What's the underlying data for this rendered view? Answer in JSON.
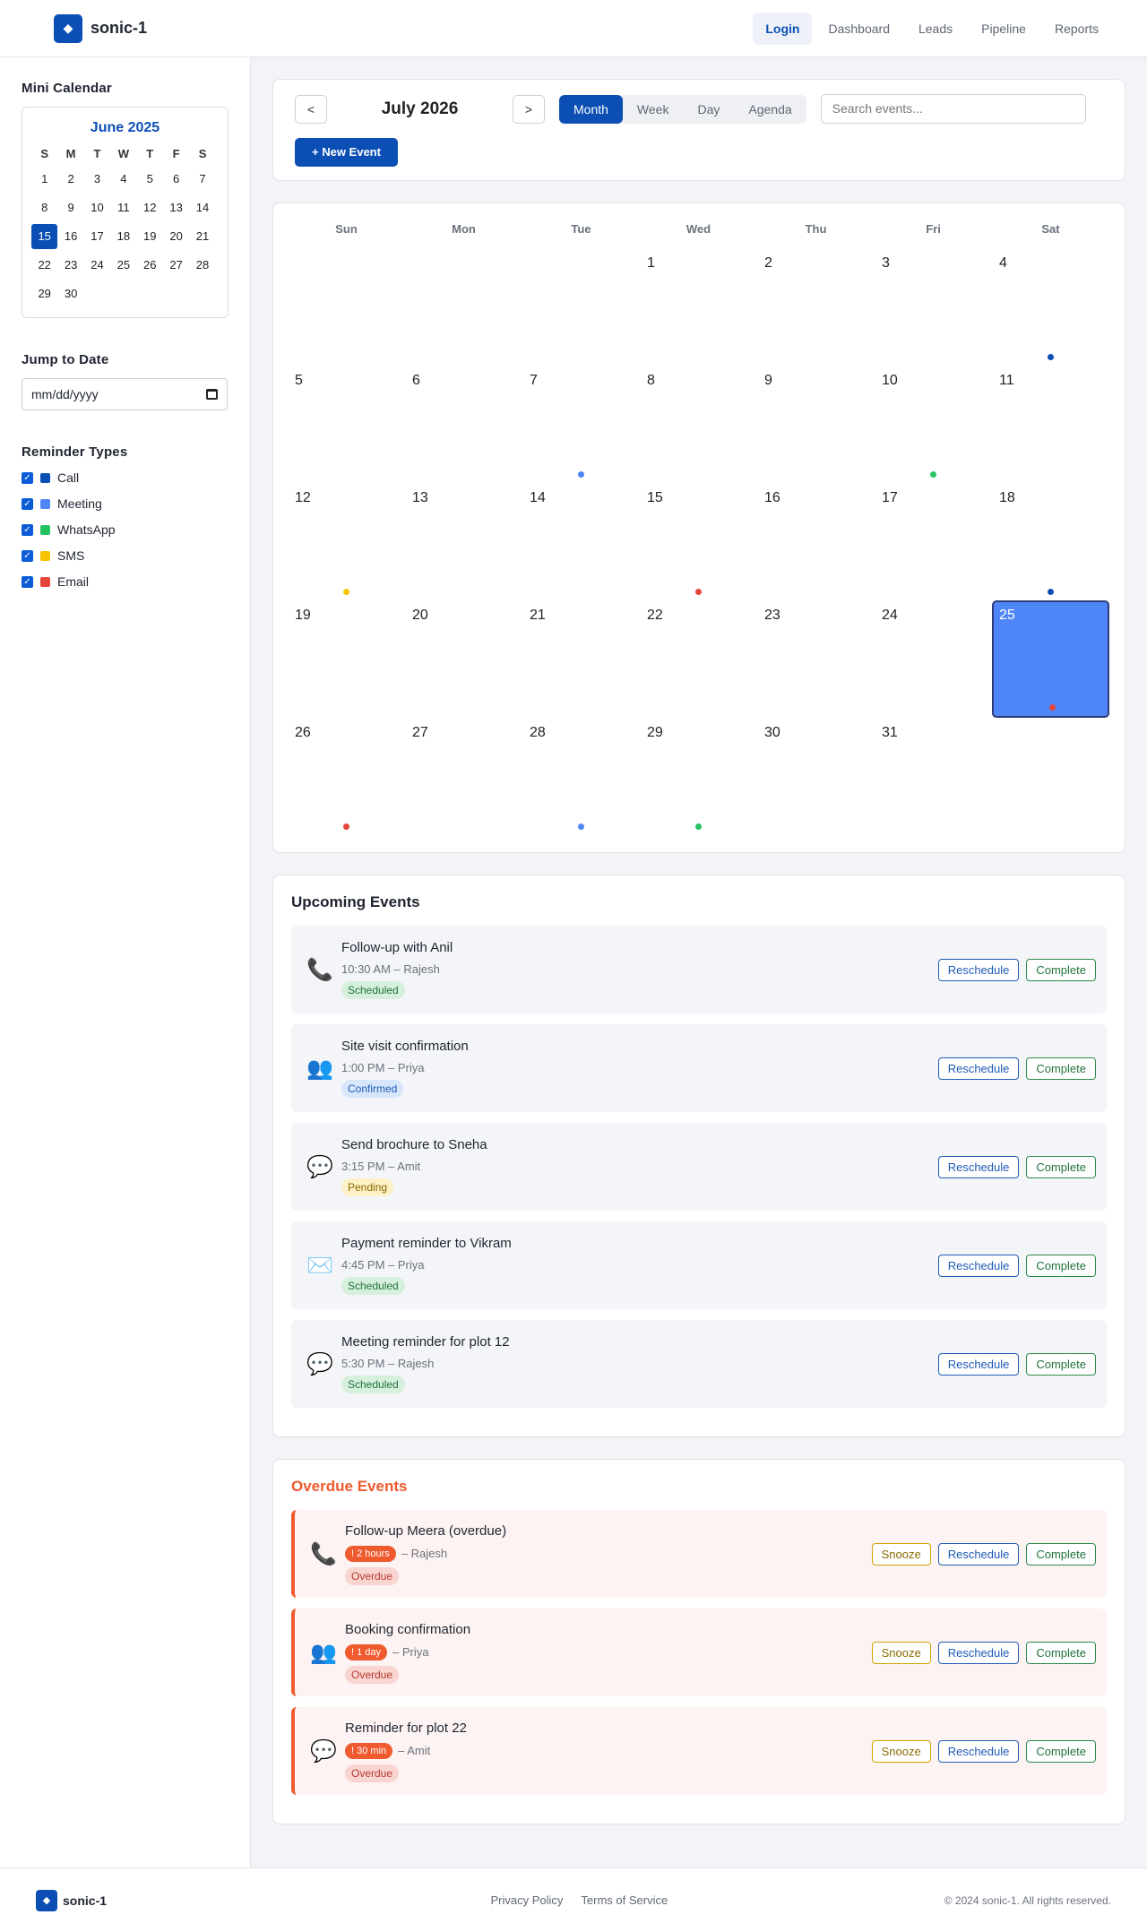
{
  "header": {
    "brand": "sonic-1",
    "nav": [
      {
        "label": "Login",
        "active": true
      },
      {
        "label": "Dashboard"
      },
      {
        "label": "Leads"
      },
      {
        "label": "Pipeline"
      },
      {
        "label": "Reports"
      }
    ]
  },
  "sidebar": {
    "mini_title": "Mini Calendar",
    "mini_month": "June 2025",
    "mini_dow": [
      "S",
      "M",
      "T",
      "W",
      "T",
      "F",
      "S"
    ],
    "mini_days": [
      "1",
      "2",
      "3",
      "4",
      "5",
      "6",
      "7",
      "8",
      "9",
      "10",
      "11",
      "12",
      "13",
      "14",
      "15",
      "16",
      "17",
      "18",
      "19",
      "20",
      "21",
      "22",
      "23",
      "24",
      "25",
      "26",
      "27",
      "28",
      "29",
      "30"
    ],
    "mini_selected": "15",
    "jump_title": "Jump to Date",
    "jump_value": "mm/dd/yyyy",
    "reminder_title": "Reminder Types",
    "reminders": [
      {
        "label": "Call",
        "color": "#0b4fb5"
      },
      {
        "label": "Meeting",
        "color": "#4f86f7"
      },
      {
        "label": "WhatsApp",
        "color": "#25c261"
      },
      {
        "label": "SMS",
        "color": "#f6c500"
      },
      {
        "label": "Email",
        "color": "#e5453a"
      }
    ]
  },
  "toolbar": {
    "prev": "<",
    "next": ">",
    "month_title": "July 2026",
    "views": [
      {
        "label": "Month",
        "active": true
      },
      {
        "label": "Week"
      },
      {
        "label": "Day"
      },
      {
        "label": "Agenda"
      }
    ],
    "search_placeholder": "Search events...",
    "new_event": "+ New Event"
  },
  "calendar": {
    "dow": [
      "Sun",
      "Mon",
      "Tue",
      "Wed",
      "Thu",
      "Fri",
      "Sat"
    ],
    "first_weekday": 3,
    "days_in_month": 31,
    "today": 25,
    "dots": {
      "4": "#0b4fb5",
      "7": "#4f86f7",
      "10": "#25c261",
      "12": "#f6c500",
      "15": "#e5453a",
      "18": "#0b4fb5",
      "25": "#e5453a",
      "28": "#4f86f7",
      "29": "#25c261",
      "26": "#e5453a"
    }
  },
  "upcoming": {
    "title": "Upcoming Events",
    "reschedule": "Reschedule",
    "complete": "Complete",
    "items": [
      {
        "icon": "phone-icon",
        "glyph": "📞",
        "title": "Follow-up with Anil",
        "meta": "10:30 AM – Rajesh",
        "status": "Scheduled",
        "status_class": "b-scheduled"
      },
      {
        "icon": "people-icon",
        "glyph": "👥",
        "title": "Site visit confirmation",
        "meta": "1:00 PM – Priya",
        "status": "Confirmed",
        "status_class": "b-confirmed"
      },
      {
        "icon": "chat-bubble-icon",
        "glyph": "💬",
        "title": "Send brochure to Sneha",
        "meta": "3:15 PM – Amit",
        "status": "Pending",
        "status_class": "b-pending"
      },
      {
        "icon": "envelope-icon",
        "glyph": "✉️",
        "title": "Payment reminder to Vikram",
        "meta": "4:45 PM – Priya",
        "status": "Scheduled",
        "status_class": "b-scheduled"
      },
      {
        "icon": "chat-bubble-icon",
        "glyph": "💬",
        "title": "Meeting reminder for plot 12",
        "meta": "5:30 PM – Rajesh",
        "status": "Scheduled",
        "status_class": "b-scheduled"
      }
    ]
  },
  "overdue": {
    "title": "Overdue Events",
    "snooze": "Snooze",
    "reschedule": "Reschedule",
    "complete": "Complete",
    "items": [
      {
        "icon": "phone-icon",
        "glyph": "📞",
        "title": "Follow-up Meera (overdue)",
        "ago": "! 2 hours",
        "meta": "– Rajesh",
        "status": "Overdue"
      },
      {
        "icon": "people-icon",
        "glyph": "👥",
        "title": "Booking confirmation",
        "ago": "! 1 day",
        "meta": "– Priya",
        "status": "Overdue"
      },
      {
        "icon": "chat-bubble-icon",
        "glyph": "💬",
        "title": "Reminder for plot 22",
        "ago": "! 30 min",
        "meta": "– Amit",
        "status": "Overdue"
      }
    ]
  },
  "footer": {
    "brand": "sonic-1",
    "links": [
      "Privacy Policy",
      "Terms of Service"
    ],
    "copyright": "© 2024 sonic-1. All rights reserved."
  }
}
